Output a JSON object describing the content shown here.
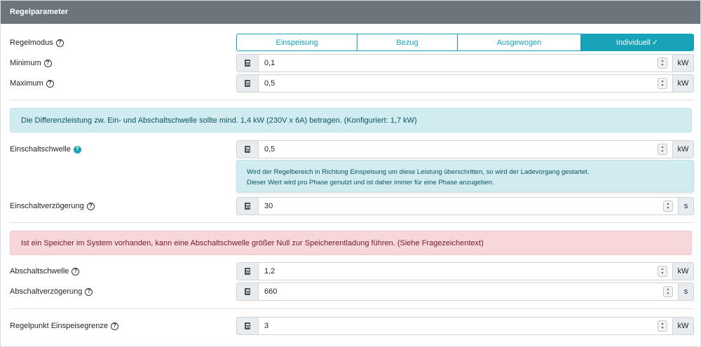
{
  "header": {
    "title": "Regelparameter"
  },
  "regelmodus": {
    "label": "Regelmodus",
    "options": [
      "Einspeisung",
      "Bezug",
      "Ausgewogen",
      "Individuell"
    ],
    "selected_check": "✓"
  },
  "minimum": {
    "label": "Minimum",
    "value": "0,1",
    "unit": "kW"
  },
  "maximum": {
    "label": "Maximum",
    "value": "0,5",
    "unit": "kW"
  },
  "info_alert": "Die Differenzleistung zw. Ein- und Abschaltschwelle sollte mind. 1,4 kW (230V x 6A) betragen. (Konfiguriert: 1,7 kW)",
  "einschaltschwelle": {
    "label": "Einschaltschwelle",
    "value": "0,5",
    "unit": "kW",
    "help_line1": "Wird der Regelbereich in Richtung Einspeisung um diese Leistung überschritten, so wird der Ladevorgang gestartet.",
    "help_line2": "Dieser Wert wird pro Phase genutzt und ist daher immer für eine Phase anzugeben."
  },
  "einschaltverzoegerung": {
    "label": "Einschaltverzögerung",
    "value": "30",
    "unit": "s"
  },
  "danger_alert": "Ist ein Speicher im System vorhanden, kann eine Abschaltschwelle größer Null zur Speicherentladung führen. (Siehe Fragezeichentext)",
  "abschaltschwelle": {
    "label": "Abschaltschwelle",
    "value": "1,2",
    "unit": "kW"
  },
  "abschaltverzoegerung": {
    "label": "Abschaltverzögerung",
    "value": "660",
    "unit": "s"
  },
  "regelpunkt": {
    "label": "Regelpunkt Einspeisegrenze",
    "value": "3",
    "unit": "kW"
  },
  "help_glyph": "?",
  "colors": {
    "accent": "#17a2b8",
    "header_bg": "#6c747c",
    "info_bg": "#d1ecf1",
    "danger_bg": "#f8d7da"
  }
}
